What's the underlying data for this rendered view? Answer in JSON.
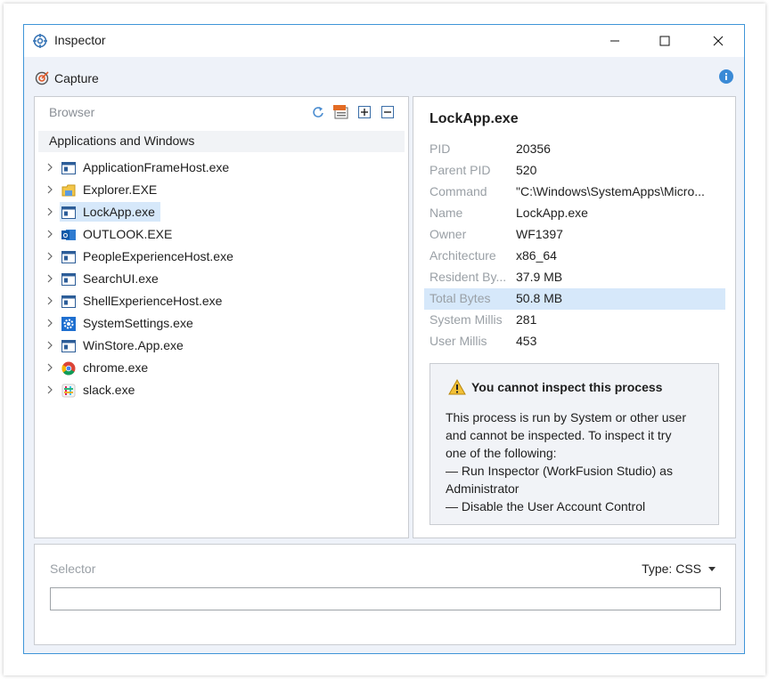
{
  "window": {
    "title": "Inspector",
    "accent": "#3f95d8"
  },
  "toolbar": {
    "capture_label": "Capture"
  },
  "browser": {
    "header": "Browser",
    "root_label": "Applications and Windows",
    "items": [
      {
        "label": "ApplicationFrameHost.exe",
        "icon": "window-app-icon"
      },
      {
        "label": "Explorer.EXE",
        "icon": "folder-icon"
      },
      {
        "label": "LockApp.exe",
        "icon": "window-app-icon"
      },
      {
        "label": "OUTLOOK.EXE",
        "icon": "outlook-icon"
      },
      {
        "label": "PeopleExperienceHost.exe",
        "icon": "window-app-icon"
      },
      {
        "label": "SearchUI.exe",
        "icon": "window-app-icon"
      },
      {
        "label": "ShellExperienceHost.exe",
        "icon": "window-app-icon"
      },
      {
        "label": "SystemSettings.exe",
        "icon": "settings-gear-icon"
      },
      {
        "label": "WinStore.App.exe",
        "icon": "window-app-icon"
      },
      {
        "label": "chrome.exe",
        "icon": "chrome-icon"
      },
      {
        "label": "slack.exe",
        "icon": "slack-icon"
      }
    ],
    "selected_index": 2
  },
  "details": {
    "title": "LockApp.exe",
    "rows": [
      {
        "key": "PID",
        "value": "20356"
      },
      {
        "key": "Parent PID",
        "value": "520"
      },
      {
        "key": "Command",
        "value": "\"C:\\Windows\\SystemApps\\Micro..."
      },
      {
        "key": "Name",
        "value": "LockApp.exe"
      },
      {
        "key": "Owner",
        "value": "WF1397"
      },
      {
        "key": "Architecture",
        "value": "x86_64"
      },
      {
        "key": "Resident By...",
        "value": "37.9 MB"
      },
      {
        "key": "Total Bytes",
        "value": "50.8 MB"
      },
      {
        "key": "System Millis",
        "value": "281"
      },
      {
        "key": "User Millis",
        "value": "453"
      }
    ],
    "highlighted_index": 7,
    "warning": {
      "title": "You cannot inspect this process",
      "lines": [
        "This process is run by System or other user",
        "and cannot be inspected. To inspect it try",
        "one of the following:",
        "— Run Inspector (WorkFusion Studio) as",
        "Administrator",
        "— Disable the User Account Control"
      ]
    }
  },
  "selector": {
    "label": "Selector",
    "type_label": "Type: CSS",
    "value": ""
  }
}
